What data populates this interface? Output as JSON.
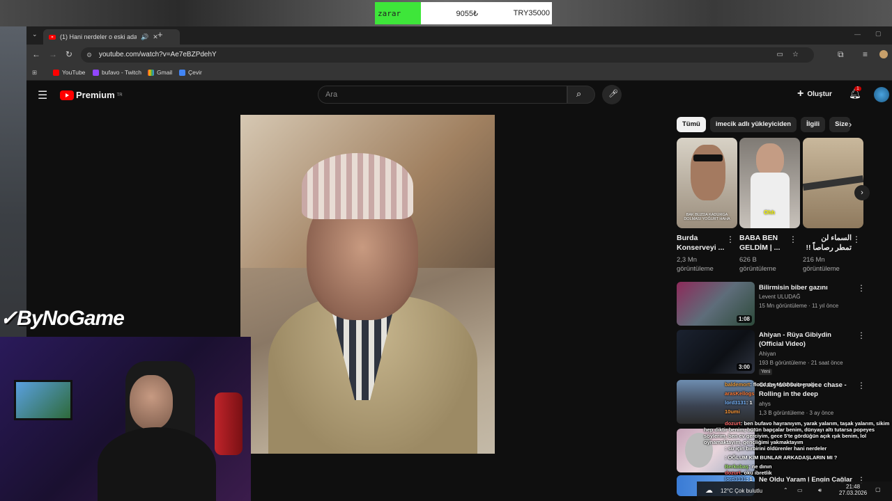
{
  "overlay": {
    "ticker": {
      "label": "zarar",
      "value1": "9055₺",
      "value2": "TRY35000"
    },
    "brand": "ByNoGame"
  },
  "browser": {
    "tab_title": "(1) Hani nerdeler o eski ada",
    "url": "youtube.com/watch?v=Ae7eBZPdehY",
    "bookmarks": [
      "YouTube",
      "bufavo - Twitch",
      "Gmail",
      "Çevir"
    ]
  },
  "youtube": {
    "logo": "Premium",
    "logo_sup": "TR",
    "search_placeholder": "Ara",
    "create_label": "Oluştur",
    "notif_count": "1",
    "chips": [
      "Tümü",
      "imecik adlı yükleyiciden",
      "İlgili",
      "Size"
    ],
    "shorts": [
      {
        "title": "Burda Konserveyi ...",
        "views": "2,3 Mn",
        "views_label": "görüntüleme",
        "caption": "BAK BUZDA KADURGA DOLMASI YOĞURT HAHA"
      },
      {
        "title": "BABA BEN GELDİM | ...",
        "views": "626 B",
        "views_label": "görüntüleme",
        "caption": "Ohh"
      },
      {
        "title": "السماء لن تمطر رصاصاً !!",
        "views": "216 Mn",
        "views_label": "görüntüleme",
        "caption": ""
      }
    ],
    "videos": [
      {
        "title": "Bilirmisin biber gazını",
        "channel": "Levent ULUDAĞ",
        "meta": "15 Mn görüntüleme · 11 yıl önce",
        "duration": "1:08"
      },
      {
        "title": "Ahiyan - Rüya Gibiydin (Official Video)",
        "channel": "Ahiyan",
        "meta": "193 B görüntüleme · 21 saat önce",
        "duration": "3:00",
        "badge": "Yeni"
      },
      {
        "title": "Crazy 1000cc police chase - Rolling in the deep",
        "channel": "ahys",
        "meta": "1,3 B görüntüleme · 3 ay önce",
        "duration": ""
      },
      {
        "title": "Ne Oldu Yaram | Engin Çağlar",
        "channel": "",
        "meta": "",
        "duration": ""
      }
    ]
  },
  "chat": [
    {
      "user": "baldemort",
      "text": ": flood the Mashsuiteenage"
    },
    {
      "user": "arasKellogs",
      "text": ""
    },
    {
      "user": "lord3131",
      "text": ": 1"
    },
    {
      "user": "10umi",
      "text": ""
    },
    {
      "user": "dozurt",
      "text": ": ben bufavo hayranıyım, yarak yalarım, taşak yalarım, sikim"
    },
    {
      "user": "",
      "text": "hep diktir benim, bütün bapçalar benim, dünyayı altı tutarsa popeyes"
    },
    {
      "user": "",
      "text": "söylerim, ben ev gerciyim, gece 5'te gördüğün açık ışık benim, lol"
    },
    {
      "user": "",
      "text": "oynamaktayım, gençliğimi yakmaktayım"
    },
    {
      "user": "",
      "text": ": su için birbirini öldürenler hani nerdeler"
    },
    {
      "user": "",
      "text": ": OĞLUM KİM BUNLAR ARKADAŞLARIN MI ?"
    },
    {
      "user": "Berkobaş",
      "text": ": ne dının"
    },
    {
      "user": "dozurt",
      "text": ": oku ibretlik"
    },
    {
      "user": "lord3131",
      "text": ": 1"
    }
  ],
  "taskbar": {
    "weather": "12°C  Çok bulutlu",
    "time": "21:48",
    "date": "27.03.2026"
  },
  "colors": {
    "youtube_red": "#ff0000",
    "bg": "#0f0f0f",
    "ticker_green": "#3ee63a"
  }
}
